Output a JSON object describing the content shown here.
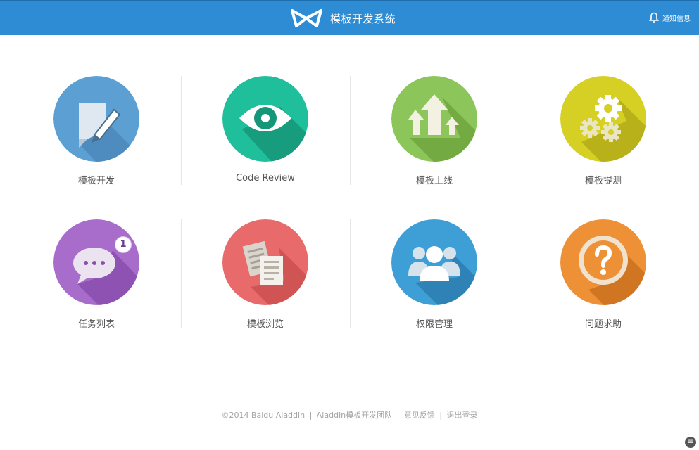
{
  "header": {
    "title": "模板开发系统",
    "notice_label": "通知信息"
  },
  "colors": {
    "header_bg": "#2d8cd4",
    "tile_dev": "#5b9fd3",
    "tile_review": "#1fbf9b",
    "tile_online": "#8cc55a",
    "tile_test": "#d6cf24",
    "tile_tasks": "#a86ccb",
    "tile_browse": "#e86a6a",
    "tile_perm": "#3e9ed6",
    "tile_help": "#ee9136"
  },
  "tiles": [
    {
      "label": "模板开发",
      "icon": "edit-document-icon"
    },
    {
      "label": "Code Review",
      "icon": "eye-icon"
    },
    {
      "label": "模板上线",
      "icon": "upload-arrows-icon"
    },
    {
      "label": "模板提测",
      "icon": "gears-icon"
    },
    {
      "label": "任务列表",
      "icon": "chat-bubble-icon",
      "badge": "1"
    },
    {
      "label": "模板浏览",
      "icon": "documents-icon"
    },
    {
      "label": "权限管理",
      "icon": "users-icon"
    },
    {
      "label": "问题求助",
      "icon": "question-icon"
    }
  ],
  "footer": {
    "copyright": "©2014 Baidu Aladdin",
    "team": "Aladdin模板开发团队",
    "feedback": "意见反馈",
    "logout": "退出登录",
    "separator": "|"
  }
}
